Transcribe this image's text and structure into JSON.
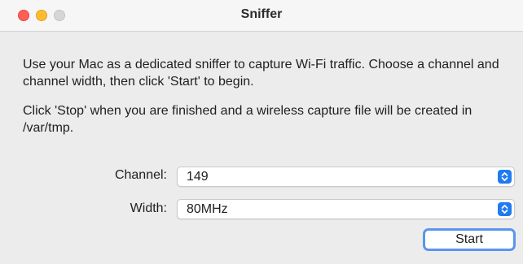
{
  "window": {
    "title": "Sniffer"
  },
  "description": {
    "paragraph1": "Use your Mac as a dedicated sniffer to capture Wi-Fi traffic. Choose a channel and channel width, then click 'Start' to begin.",
    "paragraph2": "Click 'Stop' when you are finished and a wireless capture file will be created in /var/tmp."
  },
  "form": {
    "channel_label": "Channel:",
    "channel_value": "149",
    "width_label": "Width:",
    "width_value": "80MHz"
  },
  "actions": {
    "start_label": "Start"
  },
  "icons": {
    "close": "close-traffic-light-icon",
    "minimize": "minimize-traffic-light-icon",
    "zoom": "zoom-traffic-light-icon",
    "popup_arrows": "up-down-chevron-icon"
  },
  "colors": {
    "close": "#ff5f57",
    "minimize": "#febc2e",
    "zoom_inactive": "#d6d6d6",
    "accent": "#1f7bf2",
    "focus_ring": "#5a95ee"
  }
}
